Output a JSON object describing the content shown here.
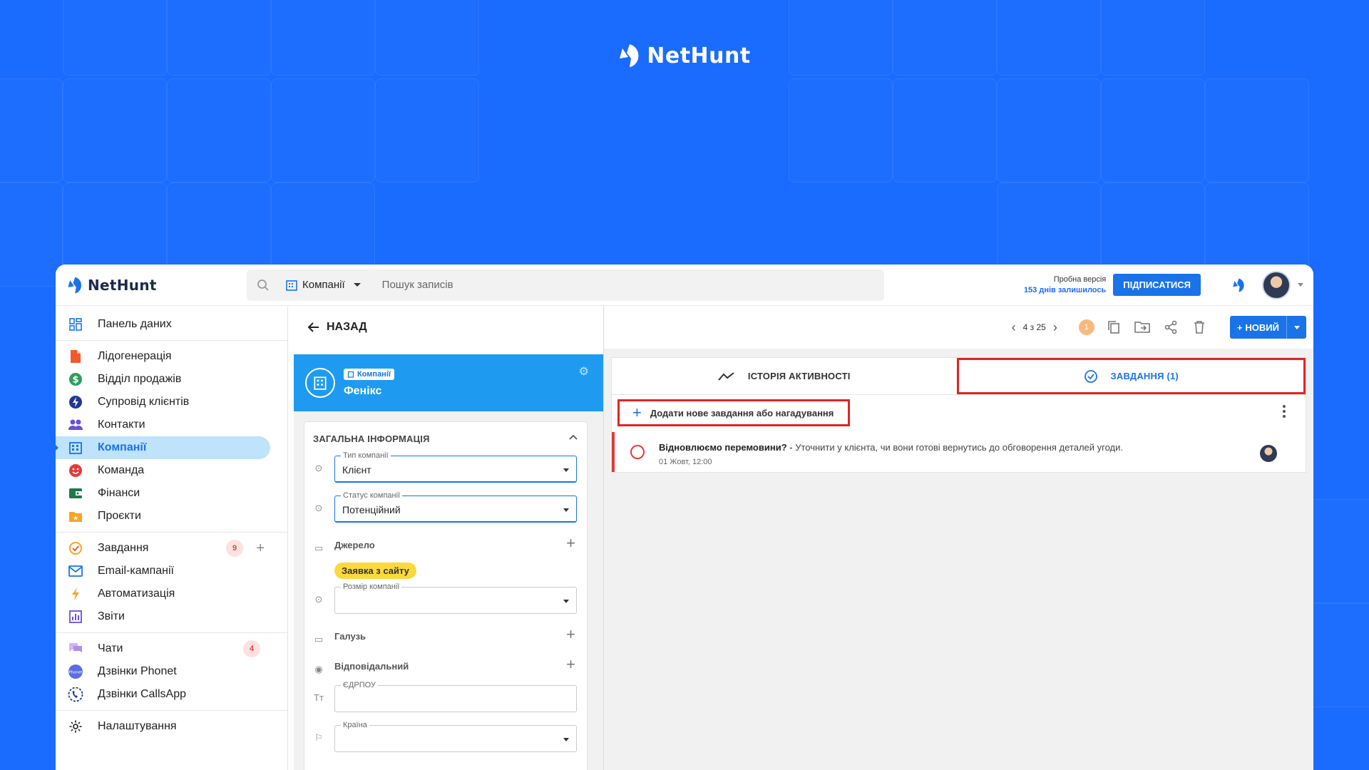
{
  "brand": {
    "name": "NetHunt"
  },
  "topbar": {
    "search_entity": "Компанії",
    "search_placeholder": "Пошук записів",
    "trial_line1": "Пробна версія",
    "trial_line2": "153 днів залишилось",
    "subscribe_label": "ПІДПИСАТИСЯ"
  },
  "sidebar": {
    "groups": [
      [
        {
          "label": "Панель даних",
          "icon": "dashboard-icon"
        }
      ],
      [
        {
          "label": "Лідогенерація",
          "icon": "file-icon"
        },
        {
          "label": "Відділ продажів",
          "icon": "dollar-icon"
        },
        {
          "label": "Супровід клієнтів",
          "icon": "lightning-icon"
        },
        {
          "label": "Контакти",
          "icon": "people-icon"
        },
        {
          "label": "Компанії",
          "icon": "building-icon",
          "active": true
        },
        {
          "label": "Команда",
          "icon": "smile-icon"
        },
        {
          "label": "Фінанси",
          "icon": "wallet-icon"
        },
        {
          "label": "Проєкти",
          "icon": "folder-star-icon"
        }
      ],
      [
        {
          "label": "Завдання",
          "icon": "check-circle-icon",
          "badge": "9",
          "plus": true
        },
        {
          "label": "Email-кампанії",
          "icon": "mail-icon"
        },
        {
          "label": "Автоматизація",
          "icon": "bolt-icon"
        },
        {
          "label": "Звіти",
          "icon": "chart-icon"
        }
      ],
      [
        {
          "label": "Чати",
          "icon": "chat-icon",
          "badge": "4"
        },
        {
          "label": "Дзвінки Phonet",
          "icon": "phonet-icon"
        },
        {
          "label": "Дзвінки CallsApp",
          "icon": "phone-icon"
        }
      ],
      [
        {
          "label": "Налаштування",
          "icon": "gear-icon"
        }
      ]
    ]
  },
  "record": {
    "back_label": "НАЗАД",
    "chip_label": "Компанії",
    "name": "Фенікс",
    "section_title": "ЗАГАЛЬНА ІНФОРМАЦІЯ",
    "fields": {
      "company_type_label": "Тип компанії",
      "company_type_value": "Клієнт",
      "company_status_label": "Статус компанії",
      "company_status_value": "Потенційний",
      "source_label": "Джерело",
      "source_tag": "Заявка з сайту",
      "size_label": "Розмір компанії",
      "industry_label": "Галузь",
      "owner_label": "Відповідальний",
      "edrpou_label": "ЄДРПОУ",
      "country_label": "Країна"
    }
  },
  "toolbar": {
    "pager_text": "4 з 25",
    "notif_count": "1",
    "new_label": "НОВИЙ"
  },
  "tabs": {
    "activity": "ІСТОРІЯ АКТИВНОСТІ",
    "tasks": "ЗАВДАННЯ (1)"
  },
  "tasks": {
    "add_label": "Додати нове завдання або нагадування",
    "items": [
      {
        "title": "Відновлюємо перемовини?",
        "separator": " - ",
        "description": "Уточнити у клієнта, чи вони готові вернутись до обговорення деталей угоди.",
        "date": "01 Жовт, 12:00"
      }
    ]
  },
  "colors": {
    "accent": "#1a73e8",
    "background": "#1a6bff",
    "highlight": "#e02424",
    "record_header": "#1e9bf0"
  }
}
